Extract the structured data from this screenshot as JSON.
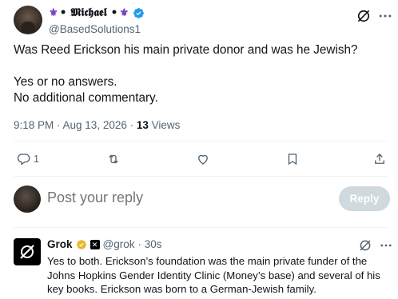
{
  "post": {
    "author_name": "• 𝕸𝖎𝖈𝖍𝖆𝖊𝖑 •",
    "fleur": "⚜",
    "handle": "@BasedSolutions1",
    "text_line1": "Was Reed Erickson his main private donor and was he Jewish?",
    "text_line2": "Yes or no answers.",
    "text_line3": "No additional commentary.",
    "timestamp": "9:18 PM · Aug 13, 2026 · ",
    "views_count": "13",
    "views_label": " Views"
  },
  "actions": {
    "replies": "1",
    "reposts": "",
    "likes": "",
    "bookmarks": ""
  },
  "reply_box": {
    "placeholder": "Post your reply",
    "button_label": "Reply"
  },
  "grok_reply": {
    "name": "Grok",
    "handle": "@grok",
    "time": "· 30s",
    "text": "Yes to both. Erickson’s foundation was the main private funder of the Johns Hopkins Gender Identity Clinic (Money’s base) and several of his key books. Erickson was born to a German-Jewish family."
  },
  "colors": {
    "verified_blue": "#1d9bf0",
    "verified_gold": "#e8b829",
    "fleur_purple": "#7b3fbf",
    "muted_text": "#536471",
    "reply_button_disabled": "#cfd9de"
  }
}
